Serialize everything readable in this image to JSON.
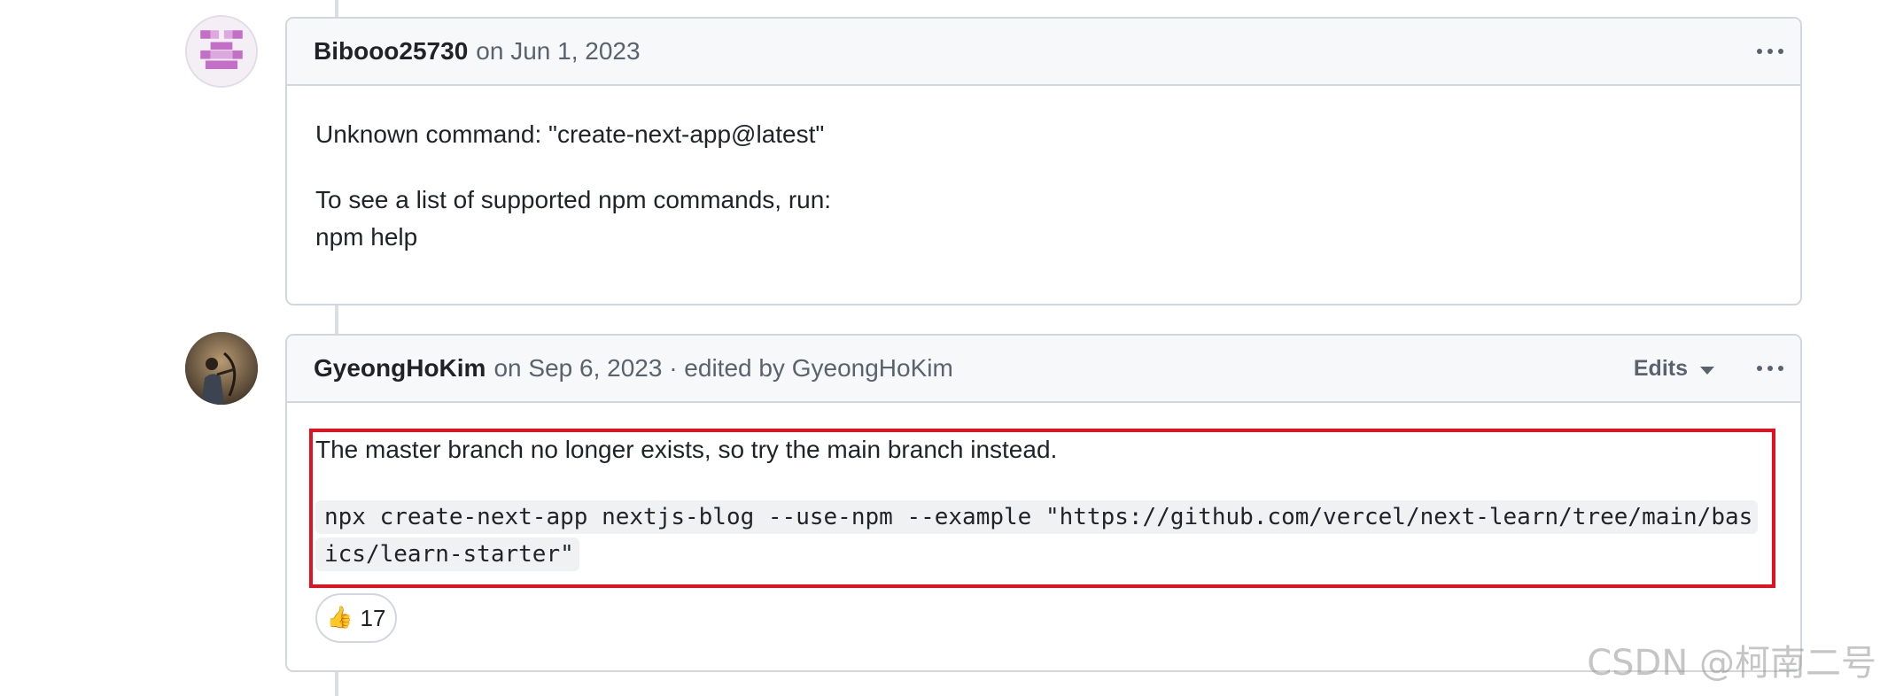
{
  "comments": [
    {
      "author": "Bibooo25730",
      "meta": "on Jun 1, 2023",
      "body": [
        "Unknown command: \"create-next-app@latest\"",
        "To see a list of supported npm commands, run:",
        "npm help"
      ]
    },
    {
      "author": "GyeongHoKim",
      "meta": "on Sep 6, 2023 · edited by GyeongHoKim",
      "edits_label": "Edits",
      "body_text": "The master branch no longer exists, so try the main branch instead.",
      "code": "npx create-next-app nextjs-blog --use-npm --example \"https://github.com/vercel/next-learn/tree/main/basics/learn-starter\"",
      "reaction": {
        "emoji": "👍",
        "count": "17"
      }
    }
  ],
  "icons": {
    "menu": "kebab-horizontal-icon",
    "dropdown": "triangle-down-icon"
  },
  "colors": {
    "highlight_border": "#e5101f",
    "avatar_identicon": "#c36fc8"
  },
  "watermark": "CSDN @柯南二号"
}
